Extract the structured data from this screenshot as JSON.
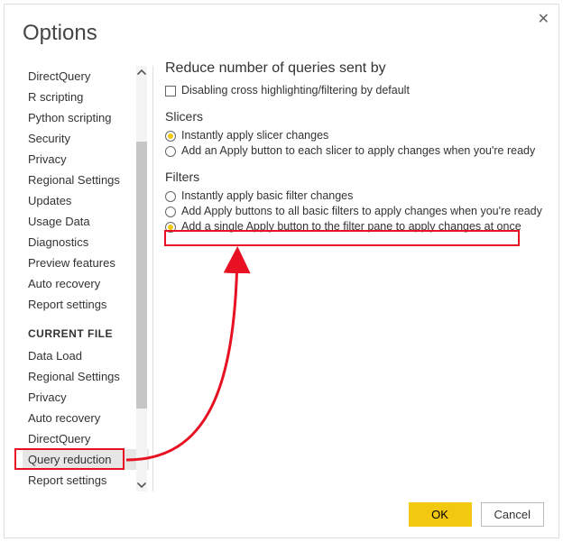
{
  "title": "Options",
  "sidebar": {
    "items_top": [
      "DirectQuery",
      "R scripting",
      "Python scripting",
      "Security",
      "Privacy",
      "Regional Settings",
      "Updates",
      "Usage Data",
      "Diagnostics",
      "Preview features",
      "Auto recovery",
      "Report settings"
    ],
    "section_label": "CURRENT FILE",
    "items_bottom": [
      "Data Load",
      "Regional Settings",
      "Privacy",
      "Auto recovery",
      "DirectQuery",
      "Query reduction",
      "Report settings"
    ],
    "selected": "Query reduction"
  },
  "content": {
    "heading": "Reduce number of queries sent by",
    "checkbox_label": "Disabling cross highlighting/filtering by default",
    "slicers_heading": "Slicers",
    "slicer_options": [
      "Instantly apply slicer changes",
      "Add an Apply button to each slicer to apply changes when you're ready"
    ],
    "slicer_selected_index": 0,
    "filters_heading": "Filters",
    "filter_options": [
      "Instantly apply basic filter changes",
      "Add Apply buttons to all basic filters to apply changes when you're ready",
      "Add a single Apply button to the filter pane to apply changes at once"
    ],
    "filter_selected_index": 2
  },
  "buttons": {
    "ok": "OK",
    "cancel": "Cancel"
  }
}
